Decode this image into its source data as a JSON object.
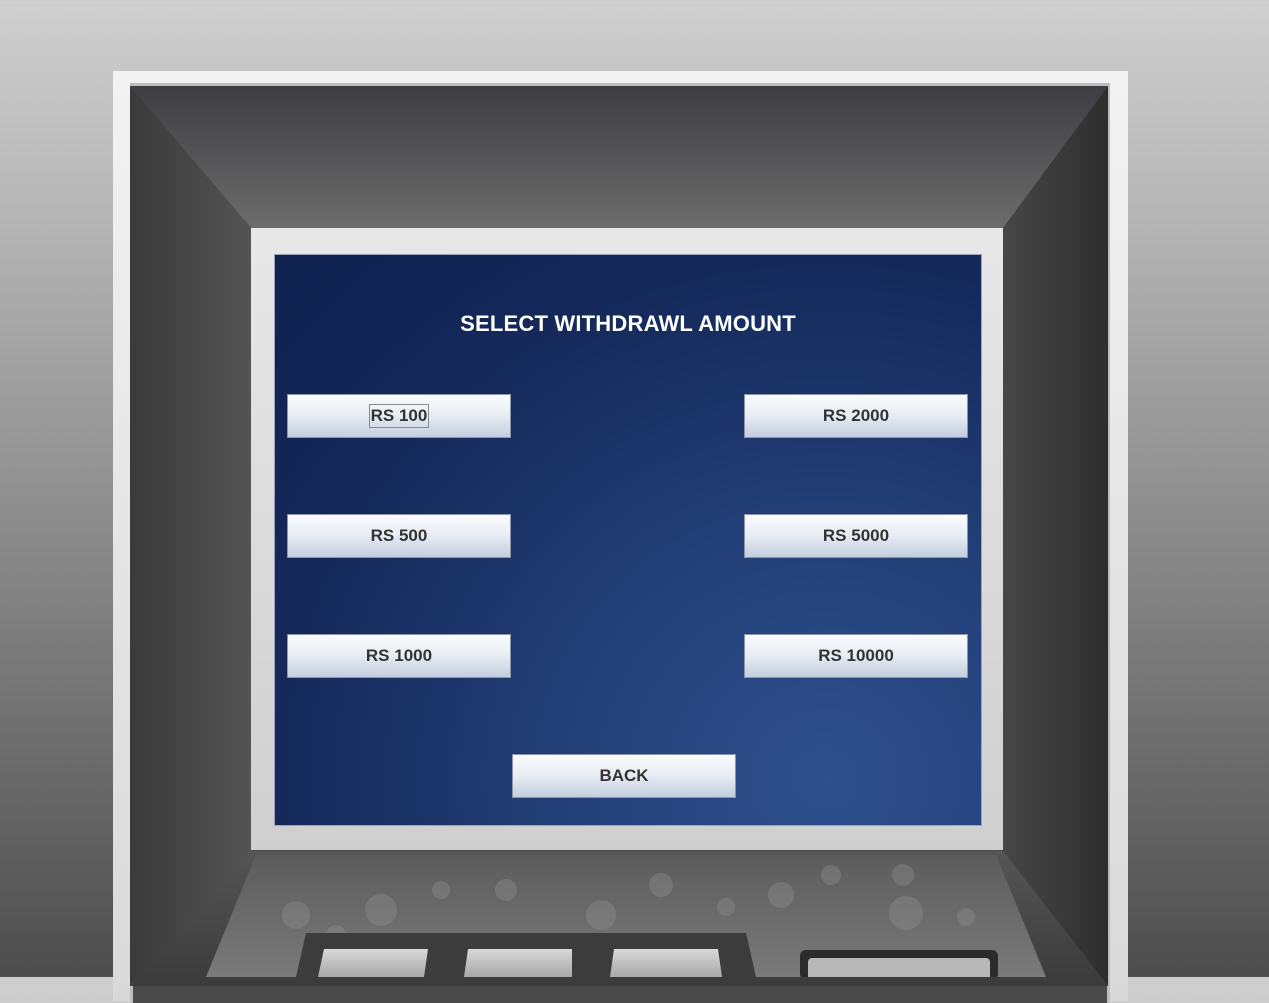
{
  "screen": {
    "title": "SELECT WITHDRAWL AMOUNT",
    "buttons": {
      "rs100": "RS 100",
      "rs500": "RS 500",
      "rs1000": "RS 1000",
      "rs2000": "RS 2000",
      "rs5000": "RS 5000",
      "rs10000": "RS 10000",
      "back": "BACK"
    }
  },
  "colors": {
    "screen_background": "#1a3366",
    "button_text": "#333333",
    "title_text": "#ffffff"
  }
}
